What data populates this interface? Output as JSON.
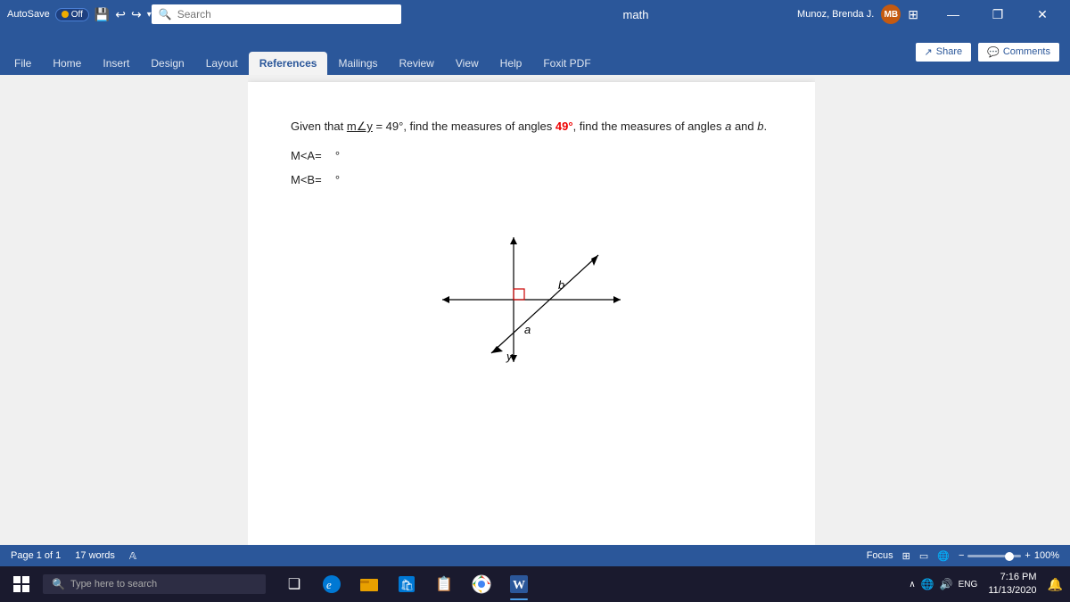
{
  "titlebar": {
    "autosave_label": "AutoSave",
    "autosave_state": "Off",
    "title": "math",
    "search_placeholder": "Search",
    "user_name": "Munoz, Brenda J.",
    "user_initials": "MB",
    "minimize": "—",
    "restore": "❐",
    "close": "✕"
  },
  "ribbon": {
    "tabs": [
      {
        "label": "File",
        "active": false
      },
      {
        "label": "Home",
        "active": false
      },
      {
        "label": "Insert",
        "active": false
      },
      {
        "label": "Design",
        "active": false
      },
      {
        "label": "Layout",
        "active": false
      },
      {
        "label": "References",
        "active": true
      },
      {
        "label": "Mailings",
        "active": false
      },
      {
        "label": "Review",
        "active": false
      },
      {
        "label": "View",
        "active": false
      },
      {
        "label": "Help",
        "active": false
      },
      {
        "label": "Foxit PDF",
        "active": false
      }
    ],
    "share_label": "Share",
    "comments_label": "Comments"
  },
  "document": {
    "problem_prefix": "Given that ",
    "problem_subject": "m∠y",
    "problem_equals": " = 49°, find the measures of angles ",
    "problem_a": "a",
    "problem_and": " and ",
    "problem_b": "b",
    "problem_end": ".",
    "line1_label": "M<A=",
    "line1_value": "°",
    "line2_label": "M<B=",
    "line2_value": "°"
  },
  "status": {
    "page_label": "Page 1 of 1",
    "words_label": "17 words",
    "focus_label": "Focus",
    "zoom_percent": "100%"
  },
  "taskbar": {
    "search_placeholder": "Type here to search",
    "time": "7:16 PM",
    "date": "11/13/2020",
    "taskbar_icons": [
      {
        "name": "windows-start",
        "symbol": "⊞"
      },
      {
        "name": "search",
        "symbol": "🔍"
      },
      {
        "name": "task-view",
        "symbol": "❑"
      },
      {
        "name": "edge-browser",
        "symbol": "e"
      },
      {
        "name": "file-explorer",
        "symbol": "📁"
      },
      {
        "name": "microsoft-store",
        "symbol": "🛍"
      },
      {
        "name": "clipboard",
        "symbol": "📋"
      },
      {
        "name": "chrome-browser",
        "symbol": "◉"
      },
      {
        "name": "word-app",
        "symbol": "W"
      }
    ]
  }
}
